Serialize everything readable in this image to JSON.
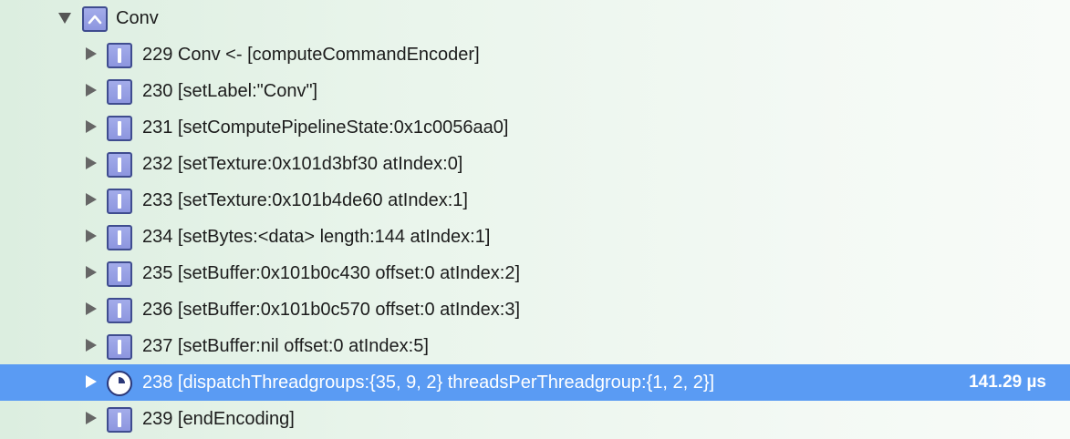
{
  "group": {
    "label": "Conv",
    "expanded": true,
    "icon": "group-up-chevron-icon"
  },
  "commands": [
    {
      "label": "229 Conv <- [computeCommandEncoder]",
      "icon": "command-icon",
      "selected": false
    },
    {
      "label": "230 [setLabel:\"Conv\"]",
      "icon": "command-icon",
      "selected": false
    },
    {
      "label": "231 [setComputePipelineState:0x1c0056aa0]",
      "icon": "command-icon",
      "selected": false
    },
    {
      "label": "232 [setTexture:0x101d3bf30 atIndex:0]",
      "icon": "command-icon",
      "selected": false
    },
    {
      "label": "233 [setTexture:0x101b4de60 atIndex:1]",
      "icon": "command-icon",
      "selected": false
    },
    {
      "label": "234 [setBytes:<data> length:144 atIndex:1]",
      "icon": "command-icon",
      "selected": false
    },
    {
      "label": "235 [setBuffer:0x101b0c430 offset:0 atIndex:2]",
      "icon": "command-icon",
      "selected": false
    },
    {
      "label": "236 [setBuffer:0x101b0c570 offset:0 atIndex:3]",
      "icon": "command-icon",
      "selected": false
    },
    {
      "label": "237 [setBuffer:nil offset:0 atIndex:5]",
      "icon": "command-icon",
      "selected": false
    },
    {
      "label": "238 [dispatchThreadgroups:{35, 9, 2} threadsPerThreadgroup:{1, 2, 2}]",
      "icon": "dispatch-clock-icon",
      "selected": true,
      "duration": "141.29 µs"
    },
    {
      "label": "239 [endEncoding]",
      "icon": "command-icon",
      "selected": false
    }
  ],
  "colors": {
    "selection": "#5a9bf3",
    "icon_fill": "#8d96df",
    "icon_border": "#3f4c8f",
    "text": "#1c1c1c",
    "background": "#eaf5ec"
  }
}
